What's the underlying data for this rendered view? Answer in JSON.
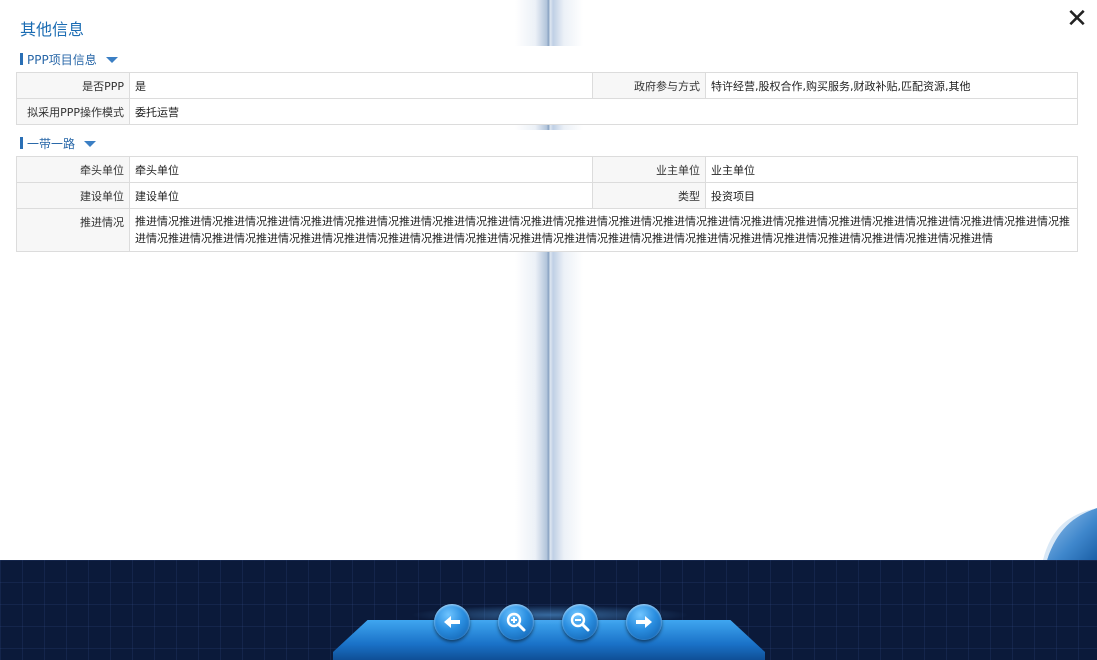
{
  "title": "其他信息",
  "close_symbol": "✕",
  "sections": {
    "ppp": {
      "heading": "PPP项目信息",
      "rows": {
        "is_ppp_label": "是否PPP",
        "is_ppp_value": "是",
        "gov_participation_label": "政府参与方式",
        "gov_participation_value": "特许经营,股权合作,购买服务,财政补贴,匹配资源,其他",
        "op_mode_label": "拟采用PPP操作模式",
        "op_mode_value": "委托运营"
      }
    },
    "belt_road": {
      "heading": "一带一路",
      "rows": {
        "lead_unit_label": "牵头单位",
        "lead_unit_value": "牵头单位",
        "owner_unit_label": "业主单位",
        "owner_unit_value": "业主单位",
        "build_unit_label": "建设单位",
        "build_unit_value": "建设单位",
        "type_label": "类型",
        "type_value": "投资项目",
        "progress_label": "推进情况",
        "progress_value": "推进情况推进情况推进情况推进情况推进情况推进情况推进情况推进情况推进情况推进情况推进情况推进情况推进情况推进情况推进情况推进情况推进情况推进情况推进情况推进情况推进情况推进情况推进情况推进情况推进情况推进情况推进情况推进情况推进情况推进情况推进情况推进情况推进情况推进情况推进情况推进情况推进情况推进情况推进情况推进情况推进情"
      }
    }
  },
  "toolbar": {
    "buttons": [
      {
        "icon": "arrow-left-icon"
      },
      {
        "icon": "zoom-in-icon"
      },
      {
        "icon": "zoom-out-icon"
      },
      {
        "icon": "arrow-right-icon"
      }
    ]
  },
  "colors": {
    "title": "#1b6cb3",
    "section_header": "#2867a8",
    "toolbar_bg": "#0b1a3a",
    "button": "#2a8ee0"
  }
}
